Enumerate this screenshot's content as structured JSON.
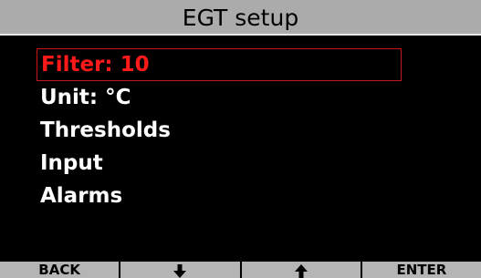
{
  "header": {
    "title": "EGT setup"
  },
  "menu": {
    "items": [
      {
        "label": "Filter: 10",
        "selected": true
      },
      {
        "label": "Unit: °C",
        "selected": false
      },
      {
        "label": "Thresholds",
        "selected": false
      },
      {
        "label": "Input",
        "selected": false
      },
      {
        "label": "Alarms",
        "selected": false
      }
    ]
  },
  "softkeys": {
    "back_label": "BACK",
    "down_icon": "arrow-down-icon",
    "up_icon": "arrow-up-icon",
    "enter_label": "ENTER"
  },
  "colors": {
    "background": "#000000",
    "title_bar": "#ababab",
    "selection": "#ff1a1a",
    "softkey": "#b5b5b5"
  }
}
